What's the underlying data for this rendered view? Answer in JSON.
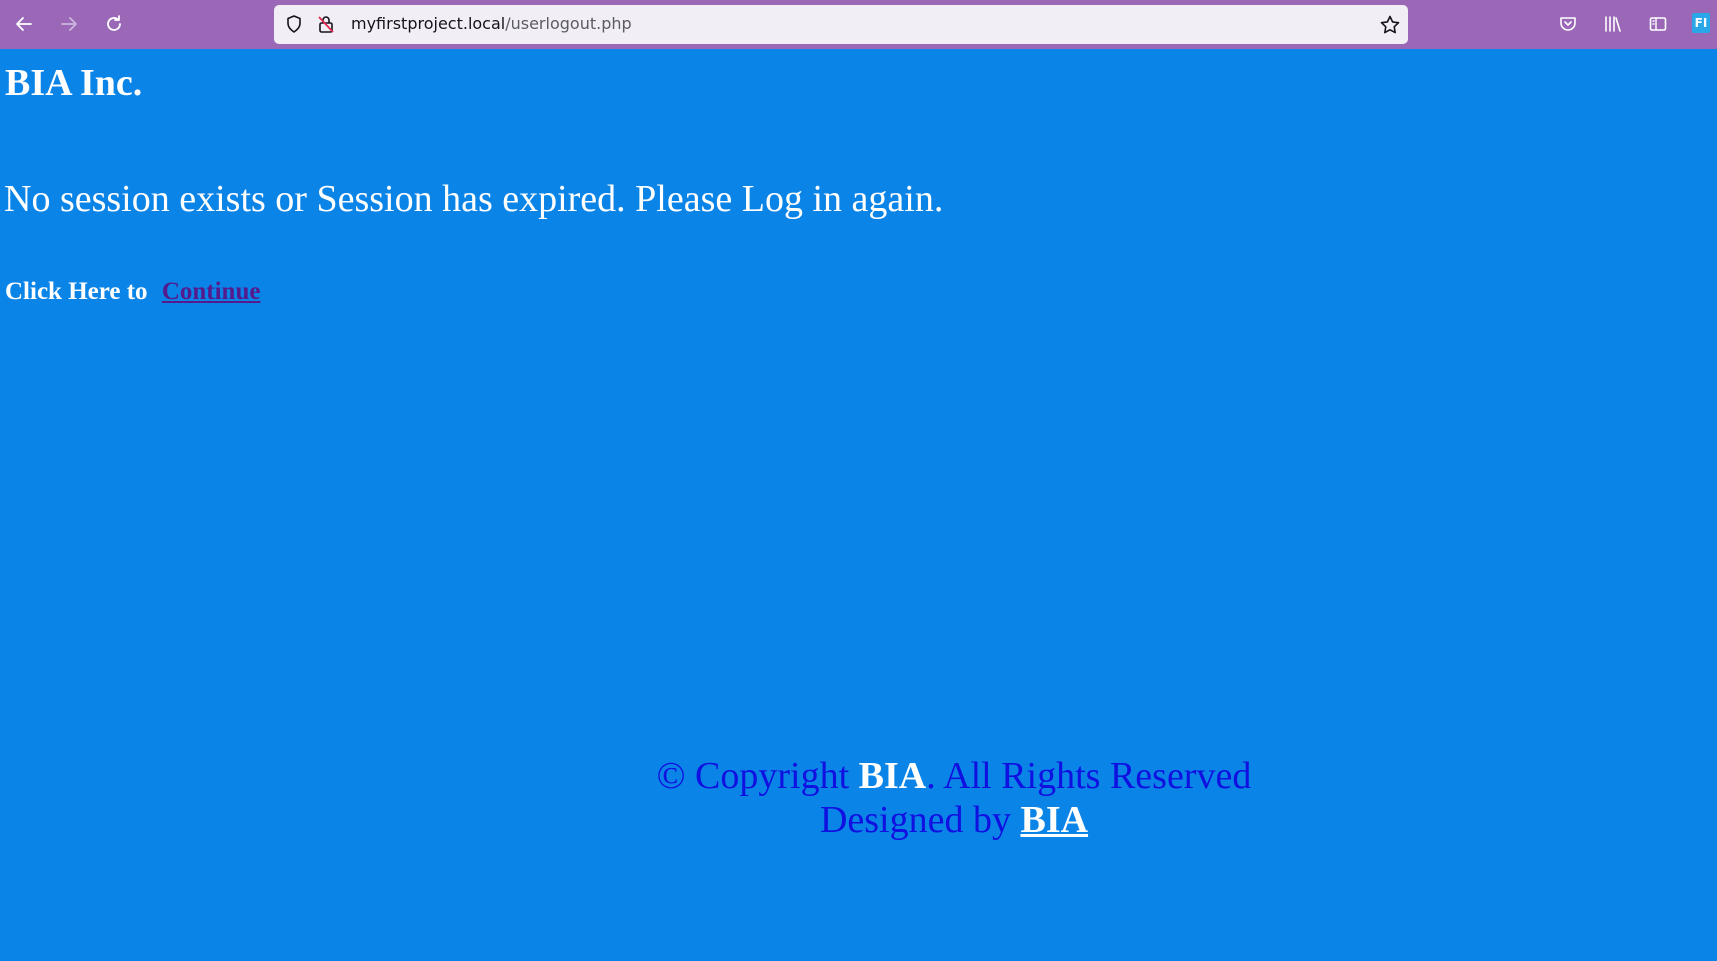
{
  "browser": {
    "url_host": "myfirstproject.local",
    "url_path": "/userlogout.php",
    "extension_badge": "FI"
  },
  "page": {
    "title": "BIA Inc.",
    "message": "No session exists or Session has expired. Please Log in again.",
    "continue_prefix": "Click Here to",
    "continue_link": "Continue"
  },
  "footer": {
    "copyright_prefix": "© Copyright",
    "copyright_brand": "BIA",
    "copyright_suffix": ". All Rights Reserved",
    "designed_prefix": "Designed by",
    "designed_link": "BIA"
  },
  "colors": {
    "page_background": "#0b84e8",
    "toolbar_background": "#9b68b8",
    "visited_link": "#551a8b",
    "footer_text": "#1010e0"
  }
}
